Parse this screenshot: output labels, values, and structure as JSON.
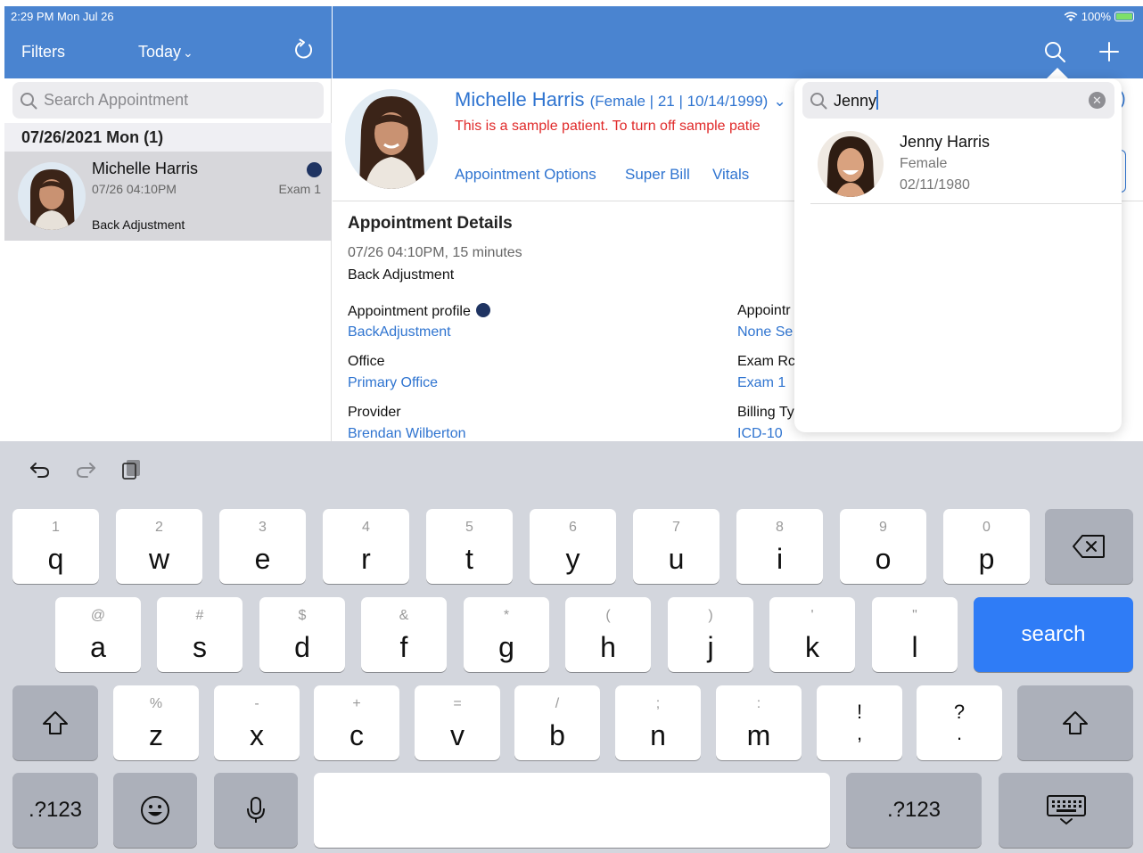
{
  "status_bar": {
    "time": "2:29 PM  Mon Jul 26",
    "battery": "100%"
  },
  "left_header": {
    "filters": "Filters",
    "today": "Today",
    "today_chevron": "⌄"
  },
  "left_panel": {
    "search_placeholder": "Search Appointment",
    "date_header": "07/26/2021 Mon (1)",
    "appointment": {
      "name": "Michelle Harris",
      "time": "07/26 04:10PM",
      "room": "Exam 1",
      "reason": "Back Adjustment"
    }
  },
  "patient": {
    "name": "Michelle Harris",
    "meta": "(Female | 21 | 10/14/1999)",
    "chevron": "⌄",
    "warning": "This is a sample patient. To turn off sample patie",
    "links": [
      "Appointment Options",
      "Super Bill",
      "Vitals"
    ]
  },
  "details": {
    "title": "Appointment Details",
    "time": "07/26 04:10PM, 15 minutes",
    "reason": "Back Adjustment",
    "fields_left": [
      {
        "label": "Appointment profile",
        "value": "BackAdjustment"
      },
      {
        "label": "Office",
        "value": "Primary Office"
      },
      {
        "label": "Provider",
        "value": "Brendan Wilberton"
      }
    ],
    "fields_right": [
      {
        "label": "Appointr",
        "value": "None Se"
      },
      {
        "label": "Exam Rc",
        "value": "Exam 1"
      },
      {
        "label": "Billing Ty",
        "value": "ICD-10"
      }
    ]
  },
  "search_popover": {
    "query": "Jenny",
    "clear_icon": "✕",
    "result": {
      "name": "Jenny Harris",
      "gender": "Female",
      "dob": "02/11/1980"
    }
  },
  "edge": {
    "paren": ")"
  },
  "keyboard": {
    "row1": [
      {
        "hint": "1",
        "ch": "q"
      },
      {
        "hint": "2",
        "ch": "w"
      },
      {
        "hint": "3",
        "ch": "e"
      },
      {
        "hint": "4",
        "ch": "r"
      },
      {
        "hint": "5",
        "ch": "t"
      },
      {
        "hint": "6",
        "ch": "y"
      },
      {
        "hint": "7",
        "ch": "u"
      },
      {
        "hint": "8",
        "ch": "i"
      },
      {
        "hint": "9",
        "ch": "o"
      },
      {
        "hint": "0",
        "ch": "p"
      }
    ],
    "row2": [
      {
        "hint": "@",
        "ch": "a"
      },
      {
        "hint": "#",
        "ch": "s"
      },
      {
        "hint": "$",
        "ch": "d"
      },
      {
        "hint": "&",
        "ch": "f"
      },
      {
        "hint": "*",
        "ch": "g"
      },
      {
        "hint": "(",
        "ch": "h"
      },
      {
        "hint": ")",
        "ch": "j"
      },
      {
        "hint": "'",
        "ch": "k"
      },
      {
        "hint": "\"",
        "ch": "l"
      }
    ],
    "row3": [
      {
        "hint": "%",
        "ch": "z"
      },
      {
        "hint": "-",
        "ch": "x"
      },
      {
        "hint": "+",
        "ch": "c"
      },
      {
        "hint": "=",
        "ch": "v"
      },
      {
        "hint": "/",
        "ch": "b"
      },
      {
        "hint": ";",
        "ch": "n"
      },
      {
        "hint": ":",
        "ch": "m"
      }
    ],
    "punct1": {
      "top": "!",
      "bottom": ","
    },
    "punct2": {
      "top": "?",
      "bottom": "."
    },
    "search_label": "search",
    "numbers_label": ".?123"
  }
}
